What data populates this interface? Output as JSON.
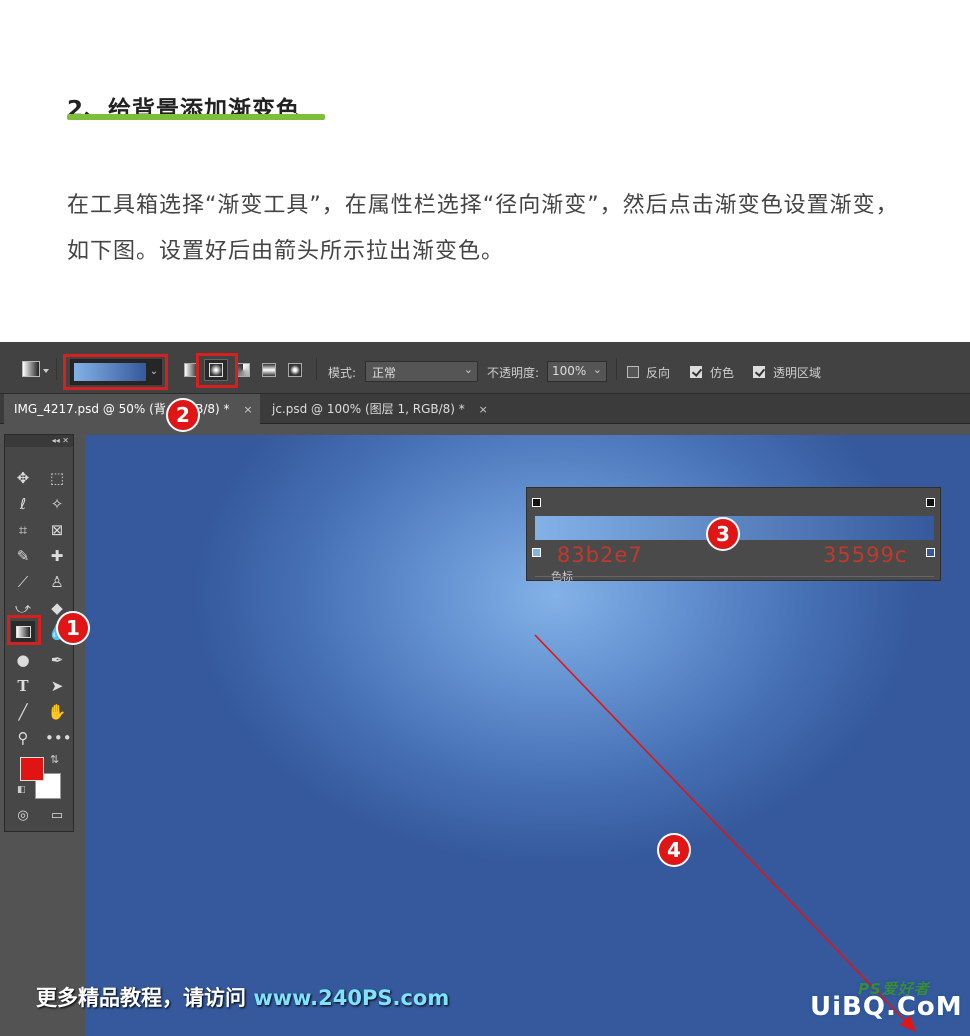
{
  "article": {
    "heading": "2、给背景添加渐变色",
    "paragraph": "在工具箱选择“渐变工具”，在属性栏选择“径向渐变”，然后点击渐变色设置渐变，如下图。设置好后由箭头所示拉出渐变色。"
  },
  "options_bar": {
    "mode_label": "模式:",
    "mode_value": "正常",
    "opacity_label": "不透明度:",
    "opacity_value": "100%",
    "reverse_label": "反向",
    "dither_label": "仿色",
    "transparency_label": "透明区域",
    "reverse_checked": false,
    "dither_checked": true,
    "transparency_checked": true
  },
  "tabs": [
    {
      "label": "IMG_4217.psd @ 50% (背",
      "suffix": "GB/8) *",
      "close": "×"
    },
    {
      "label": "jc.psd @ 100% (图层 1, RGB/8) *",
      "close": "×"
    }
  ],
  "toolbox_header": "◂◂ ✕",
  "gradient_editor": {
    "left_color_hex": "83b2e7",
    "right_color_hex": "35599c",
    "stops_label": "色标"
  },
  "colors": {
    "gradient_start": "#83b2e7",
    "gradient_end": "#35599c",
    "foreground": "#e11414",
    "background": "#ffffff",
    "highlight": "#d61f1f"
  },
  "badges": [
    "1",
    "2",
    "3",
    "4"
  ],
  "watermark": {
    "left_text": "更多精品教程，请访问 ",
    "left_url": "www.240PS.com",
    "right_text": "UiBQ.CoM",
    "right_logo": "PS爱好者"
  }
}
